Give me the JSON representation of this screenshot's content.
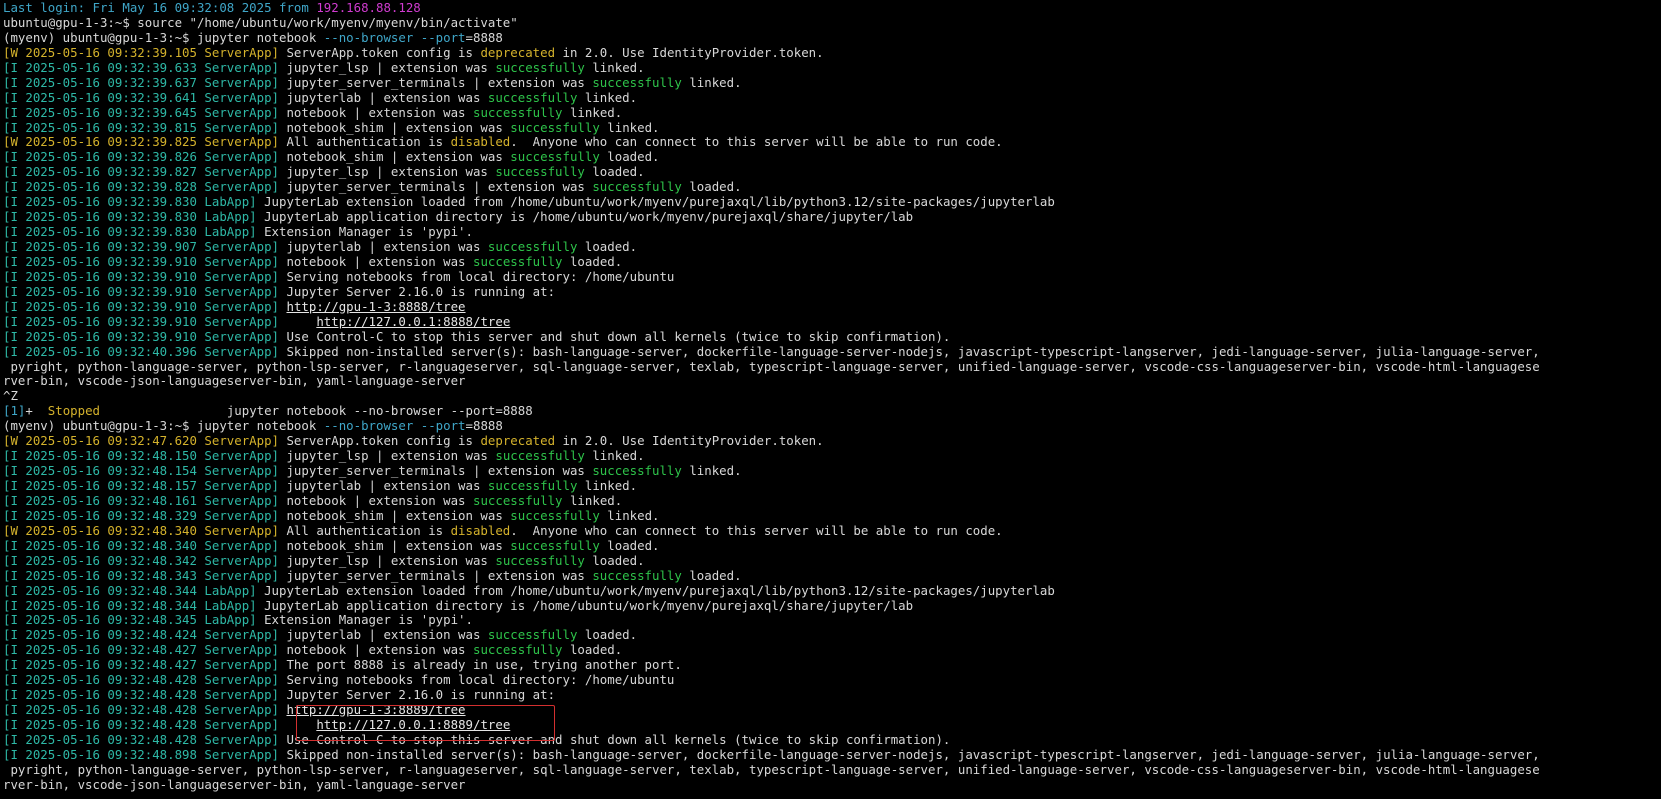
{
  "terminal": {
    "colors": {
      "background": "#000000",
      "default": "#d8d8d8",
      "cyan": "#3fa6c8",
      "teal": "#2eb8a6",
      "green": "#2ec34a",
      "yellow": "#d4b22c",
      "magenta": "#d03bd0",
      "highlight": "#d32f2f"
    },
    "lines": [
      [
        [
          "Last login: Fri May 16 09:32:08 2025 from ",
          "cyan"
        ],
        [
          "192.168.88.128",
          "magenta"
        ]
      ],
      [
        [
          "ubuntu@gpu-1-3:~$ source \"/home/ubuntu/work/myenv/myenv/bin/activate\"",
          "default"
        ]
      ],
      [
        [
          "(myenv) ubuntu@gpu-1-3:~$ jupyter notebook ",
          "default"
        ],
        [
          "--no-browser --port",
          "cyan"
        ],
        [
          "=8888",
          "default"
        ]
      ],
      [
        [
          "[W 2025-05-16 09:32:39.105 ServerApp]",
          "yellow"
        ],
        [
          " ServerApp.token config is ",
          "default"
        ],
        [
          "deprecated",
          "yellow"
        ],
        [
          " in 2.0. Use IdentityProvider.token.",
          "default"
        ]
      ],
      [
        [
          "[I 2025-05-16 09:32:39.633 ServerApp]",
          "teal"
        ],
        [
          " jupyter_lsp | extension was ",
          "default"
        ],
        [
          "successfully",
          "green"
        ],
        [
          " linked.",
          "default"
        ]
      ],
      [
        [
          "[I 2025-05-16 09:32:39.637 ServerApp]",
          "teal"
        ],
        [
          " jupyter_server_terminals | extension was ",
          "default"
        ],
        [
          "successfully",
          "green"
        ],
        [
          " linked.",
          "default"
        ]
      ],
      [
        [
          "[I 2025-05-16 09:32:39.641 ServerApp]",
          "teal"
        ],
        [
          " jupyterlab | extension was ",
          "default"
        ],
        [
          "successfully",
          "green"
        ],
        [
          " linked.",
          "default"
        ]
      ],
      [
        [
          "[I 2025-05-16 09:32:39.645 ServerApp]",
          "teal"
        ],
        [
          " notebook | extension was ",
          "default"
        ],
        [
          "successfully",
          "green"
        ],
        [
          " linked.",
          "default"
        ]
      ],
      [
        [
          "[I 2025-05-16 09:32:39.815 ServerApp]",
          "teal"
        ],
        [
          " notebook_shim | extension was ",
          "default"
        ],
        [
          "successfully",
          "green"
        ],
        [
          " linked.",
          "default"
        ]
      ],
      [
        [
          "[W 2025-05-16 09:32:39.825 ServerApp]",
          "yellow"
        ],
        [
          " All authentication is ",
          "default"
        ],
        [
          "disabled",
          "yellow"
        ],
        [
          ".  Anyone who can connect to this server will be able to run code.",
          "default"
        ]
      ],
      [
        [
          "[I 2025-05-16 09:32:39.826 ServerApp]",
          "teal"
        ],
        [
          " notebook_shim | extension was ",
          "default"
        ],
        [
          "successfully",
          "green"
        ],
        [
          " loaded.",
          "default"
        ]
      ],
      [
        [
          "[I 2025-05-16 09:32:39.827 ServerApp]",
          "teal"
        ],
        [
          " jupyter_lsp | extension was ",
          "default"
        ],
        [
          "successfully",
          "green"
        ],
        [
          " loaded.",
          "default"
        ]
      ],
      [
        [
          "[I 2025-05-16 09:32:39.828 ServerApp]",
          "teal"
        ],
        [
          " jupyter_server_terminals | extension was ",
          "default"
        ],
        [
          "successfully",
          "green"
        ],
        [
          " loaded.",
          "default"
        ]
      ],
      [
        [
          "[I 2025-05-16 09:32:39.830 LabApp]",
          "teal"
        ],
        [
          " JupyterLab extension loaded from /home/ubuntu/work/myenv/purejaxql/lib/python3.12/site-packages/jupyterlab",
          "default"
        ]
      ],
      [
        [
          "[I 2025-05-16 09:32:39.830 LabApp]",
          "teal"
        ],
        [
          " JupyterLab application directory is /home/ubuntu/work/myenv/purejaxql/share/jupyter/lab",
          "default"
        ]
      ],
      [
        [
          "[I 2025-05-16 09:32:39.830 LabApp]",
          "teal"
        ],
        [
          " Extension Manager is 'pypi'.",
          "default"
        ]
      ],
      [
        [
          "[I 2025-05-16 09:32:39.907 ServerApp]",
          "teal"
        ],
        [
          " jupyterlab | extension was ",
          "default"
        ],
        [
          "successfully",
          "green"
        ],
        [
          " loaded.",
          "default"
        ]
      ],
      [
        [
          "[I 2025-05-16 09:32:39.910 ServerApp]",
          "teal"
        ],
        [
          " notebook | extension was ",
          "default"
        ],
        [
          "successfully",
          "green"
        ],
        [
          " loaded.",
          "default"
        ]
      ],
      [
        [
          "[I 2025-05-16 09:32:39.910 ServerApp]",
          "teal"
        ],
        [
          " Serving notebooks from local directory: /home/ubuntu",
          "default"
        ]
      ],
      [
        [
          "[I 2025-05-16 09:32:39.910 ServerApp]",
          "teal"
        ],
        [
          " Jupyter Server 2.16.0 is running at:",
          "default"
        ]
      ],
      [
        [
          "[I 2025-05-16 09:32:39.910 ServerApp]",
          "teal"
        ],
        [
          " ",
          "default"
        ],
        [
          "http://gpu-1-3:8888/tree",
          "link"
        ]
      ],
      [
        [
          "[I 2025-05-16 09:32:39.910 ServerApp]",
          "teal"
        ],
        [
          "     ",
          "default"
        ],
        [
          "http://127.0.0.1:8888/tree",
          "link"
        ]
      ],
      [
        [
          "[I 2025-05-16 09:32:39.910 ServerApp]",
          "teal"
        ],
        [
          " Use Control-C to stop this server and shut down all kernels (twice to skip confirmation).",
          "default"
        ]
      ],
      [
        [
          "[I 2025-05-16 09:32:40.396 ServerApp]",
          "teal"
        ],
        [
          " Skipped non-installed server(s): bash-language-server, dockerfile-language-server-nodejs, javascript-typescript-langserver, jedi-language-server, julia-language-server,",
          "default"
        ]
      ],
      [
        [
          " pyright, python-language-server, python-lsp-server, r-languageserver, sql-language-server, texlab, typescript-language-server, unified-language-server, vscode-css-languageserver-bin, vscode-html-languagese",
          "default"
        ]
      ],
      [
        [
          "rver-bin, vscode-json-languageserver-bin, yaml-language-server",
          "default"
        ]
      ],
      [
        [
          "^Z",
          "default"
        ]
      ],
      [
        [
          "[1]",
          "cyan"
        ],
        [
          "+  ",
          "default"
        ],
        [
          "Stopped",
          "yellow"
        ],
        [
          "                 jupyter notebook --no-browser --port=8888",
          "default"
        ]
      ],
      [
        [
          "(myenv) ubuntu@gpu-1-3:~$ jupyter notebook ",
          "default"
        ],
        [
          "--no-browser --port",
          "cyan"
        ],
        [
          "=8888",
          "default"
        ]
      ],
      [
        [
          "[W 2025-05-16 09:32:47.620 ServerApp]",
          "yellow"
        ],
        [
          " ServerApp.token config is ",
          "default"
        ],
        [
          "deprecated",
          "yellow"
        ],
        [
          " in 2.0. Use IdentityProvider.token.",
          "default"
        ]
      ],
      [
        [
          "[I 2025-05-16 09:32:48.150 ServerApp]",
          "teal"
        ],
        [
          " jupyter_lsp | extension was ",
          "default"
        ],
        [
          "successfully",
          "green"
        ],
        [
          " linked.",
          "default"
        ]
      ],
      [
        [
          "[I 2025-05-16 09:32:48.154 ServerApp]",
          "teal"
        ],
        [
          " jupyter_server_terminals | extension was ",
          "default"
        ],
        [
          "successfully",
          "green"
        ],
        [
          " linked.",
          "default"
        ]
      ],
      [
        [
          "[I 2025-05-16 09:32:48.157 ServerApp]",
          "teal"
        ],
        [
          " jupyterlab | extension was ",
          "default"
        ],
        [
          "successfully",
          "green"
        ],
        [
          " linked.",
          "default"
        ]
      ],
      [
        [
          "[I 2025-05-16 09:32:48.161 ServerApp]",
          "teal"
        ],
        [
          " notebook | extension was ",
          "default"
        ],
        [
          "successfully",
          "green"
        ],
        [
          " linked.",
          "default"
        ]
      ],
      [
        [
          "[I 2025-05-16 09:32:48.329 ServerApp]",
          "teal"
        ],
        [
          " notebook_shim | extension was ",
          "default"
        ],
        [
          "successfully",
          "green"
        ],
        [
          " linked.",
          "default"
        ]
      ],
      [
        [
          "[W 2025-05-16 09:32:48.340 ServerApp]",
          "yellow"
        ],
        [
          " All authentication is ",
          "default"
        ],
        [
          "disabled",
          "yellow"
        ],
        [
          ".  Anyone who can connect to this server will be able to run code.",
          "default"
        ]
      ],
      [
        [
          "[I 2025-05-16 09:32:48.340 ServerApp]",
          "teal"
        ],
        [
          " notebook_shim | extension was ",
          "default"
        ],
        [
          "successfully",
          "green"
        ],
        [
          " loaded.",
          "default"
        ]
      ],
      [
        [
          "[I 2025-05-16 09:32:48.342 ServerApp]",
          "teal"
        ],
        [
          " jupyter_lsp | extension was ",
          "default"
        ],
        [
          "successfully",
          "green"
        ],
        [
          " loaded.",
          "default"
        ]
      ],
      [
        [
          "[I 2025-05-16 09:32:48.343 ServerApp]",
          "teal"
        ],
        [
          " jupyter_server_terminals | extension was ",
          "default"
        ],
        [
          "successfully",
          "green"
        ],
        [
          " loaded.",
          "default"
        ]
      ],
      [
        [
          "[I 2025-05-16 09:32:48.344 LabApp]",
          "teal"
        ],
        [
          " JupyterLab extension loaded from /home/ubuntu/work/myenv/purejaxql/lib/python3.12/site-packages/jupyterlab",
          "default"
        ]
      ],
      [
        [
          "[I 2025-05-16 09:32:48.344 LabApp]",
          "teal"
        ],
        [
          " JupyterLab application directory is /home/ubuntu/work/myenv/purejaxql/share/jupyter/lab",
          "default"
        ]
      ],
      [
        [
          "[I 2025-05-16 09:32:48.345 LabApp]",
          "teal"
        ],
        [
          " Extension Manager is 'pypi'.",
          "default"
        ]
      ],
      [
        [
          "[I 2025-05-16 09:32:48.424 ServerApp]",
          "teal"
        ],
        [
          " jupyterlab | extension was ",
          "default"
        ],
        [
          "successfully",
          "green"
        ],
        [
          " loaded.",
          "default"
        ]
      ],
      [
        [
          "[I 2025-05-16 09:32:48.427 ServerApp]",
          "teal"
        ],
        [
          " notebook | extension was ",
          "default"
        ],
        [
          "successfully",
          "green"
        ],
        [
          " loaded.",
          "default"
        ]
      ],
      [
        [
          "[I 2025-05-16 09:32:48.427 ServerApp]",
          "teal"
        ],
        [
          " The port 8888 is already in use, trying another port.",
          "default"
        ]
      ],
      [
        [
          "[I 2025-05-16 09:32:48.428 ServerApp]",
          "teal"
        ],
        [
          " Serving notebooks from local directory: /home/ubuntu",
          "default"
        ]
      ],
      [
        [
          "[I 2025-05-16 09:32:48.428 ServerApp]",
          "teal"
        ],
        [
          " Jupyter Server 2.16.0 is running at:",
          "default"
        ]
      ],
      [
        [
          "[I 2025-05-16 09:32:48.428 ServerApp]",
          "teal"
        ],
        [
          " ",
          "default"
        ],
        [
          "http://gpu-1-3:8889/tree",
          "link"
        ]
      ],
      [
        [
          "[I 2025-05-16 09:32:48.428 ServerApp]",
          "teal"
        ],
        [
          "     ",
          "default"
        ],
        [
          "http://127.0.0.1:8889/tree",
          "link"
        ]
      ],
      [
        [
          "[I 2025-05-16 09:32:48.428 ServerApp]",
          "teal"
        ],
        [
          " Use Control-C to stop this server and shut down all kernels (twice to skip confirmation).",
          "default"
        ]
      ],
      [
        [
          "[I 2025-05-16 09:32:48.898 ServerApp]",
          "teal"
        ],
        [
          " Skipped non-installed server(s): bash-language-server, dockerfile-language-server-nodejs, javascript-typescript-langserver, jedi-language-server, julia-language-server,",
          "default"
        ]
      ],
      [
        [
          " pyright, python-language-server, python-lsp-server, r-languageserver, sql-language-server, texlab, typescript-language-server, unified-language-server, vscode-css-languageserver-bin, vscode-html-languagese",
          "default"
        ]
      ],
      [
        [
          "rver-bin, vscode-json-languageserver-bin, yaml-language-server",
          "default"
        ]
      ]
    ]
  }
}
